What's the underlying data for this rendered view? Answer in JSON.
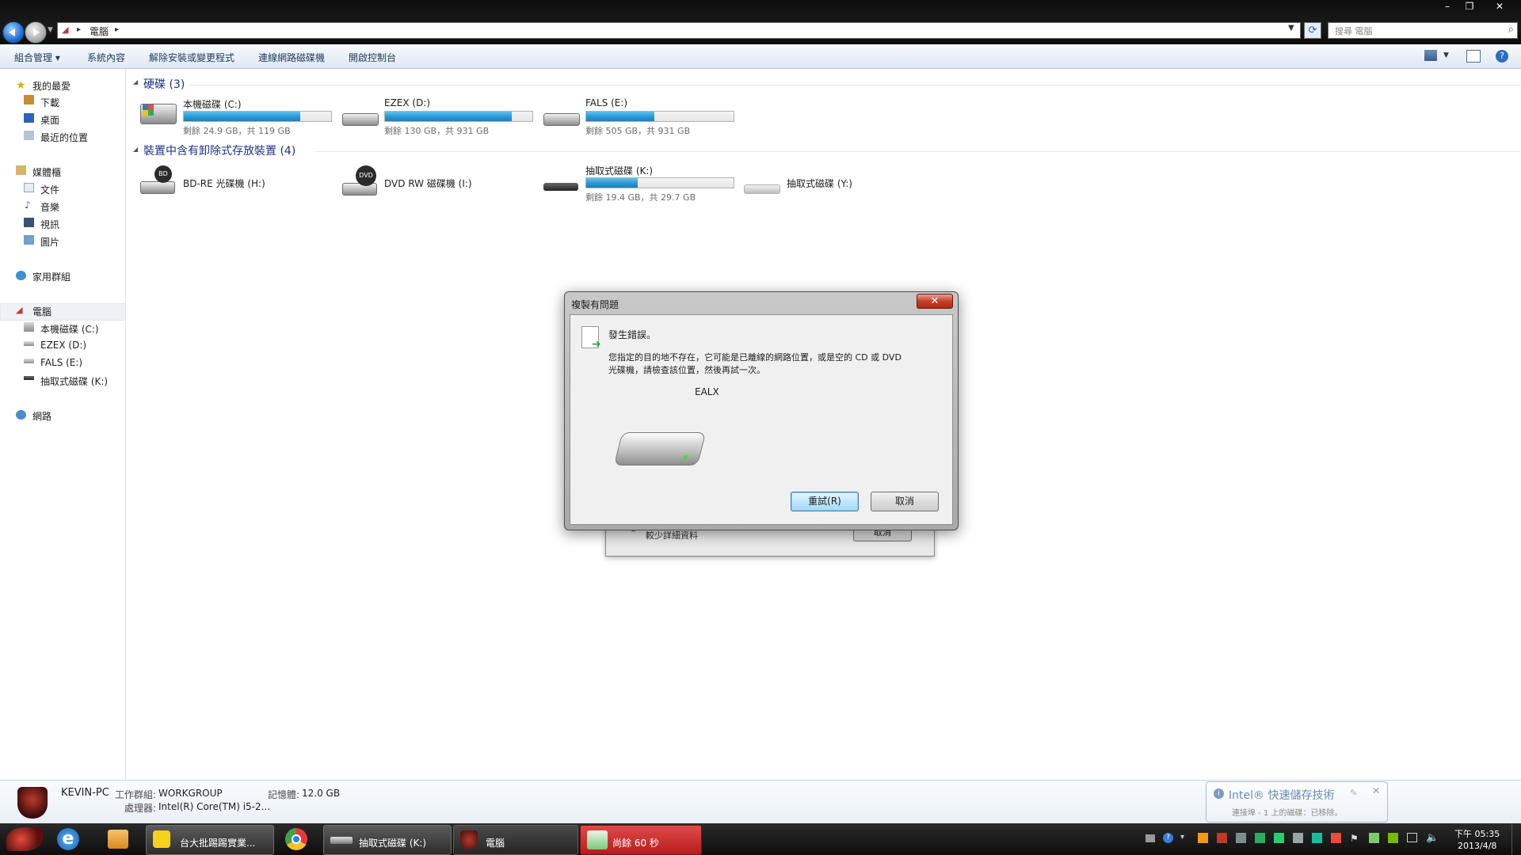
{
  "window": {
    "address": {
      "crumb": "電腦"
    },
    "search_placeholder": "搜尋 電腦",
    "controls": {
      "minimize": "–",
      "restore": "❐",
      "close": "✕"
    }
  },
  "command_bar": {
    "organize": "組合管理",
    "system_properties": "系統內容",
    "uninstall": "解除安裝或變更程式",
    "map_drive": "連線網路磁碟機",
    "control_panel": "開啟控制台"
  },
  "nav": {
    "favorites": "我的最愛",
    "downloads": "下載",
    "desktop": "桌面",
    "recent": "最近的位置",
    "libraries": "媒體櫃",
    "documents": "文件",
    "music": "音樂",
    "videos": "視訊",
    "pictures": "圖片",
    "homegroup": "家用群組",
    "computer": "電腦",
    "drive_c": "本機磁碟 (C:)",
    "drive_d": "EZEX (D:)",
    "drive_e": "FALS (E:)",
    "drive_k": "抽取式磁碟 (K:)",
    "network": "網路"
  },
  "content": {
    "hard_disks_header": "硬碟 (3)",
    "removable_header": "裝置中含有卸除式存放裝置 (4)",
    "drives": [
      {
        "name": "本機磁碟 (C:)",
        "free": "剩餘 24.9 GB，共 119 GB",
        "used_fraction": 0.79
      },
      {
        "name": "EZEX (D:)",
        "free": "剩餘 130 GB，共 931 GB",
        "used_fraction": 0.86
      },
      {
        "name": "FALS (E:)",
        "free": "剩餘 505 GB，共 931 GB",
        "used_fraction": 0.46
      }
    ],
    "removable": [
      {
        "name": "BD-RE 光碟機 (H:)",
        "badge": "BD"
      },
      {
        "name": "DVD RW 磁碟機 (I:)",
        "badge": "DVD"
      },
      {
        "name": "抽取式磁碟 (K:)",
        "free": "剩餘 19.4 GB，共 29.7 GB",
        "used_fraction": 0.35
      },
      {
        "name": "抽取式磁碟 (Y:)"
      }
    ]
  },
  "dialog": {
    "title": "複製有問題",
    "close": "✕",
    "heading": "發生錯誤。",
    "message_line1": "您指定的目的地不存在，它可能是已離線的網路位置，或是空的 CD 或 DVD",
    "message_line2": "光碟機，請檢查該位置，然後再試一次。",
    "item_name": "EALX",
    "retry_label": "重試(R)",
    "cancel_label": "取消"
  },
  "dialog_behind": {
    "less_details": "較少詳細資料",
    "cancel_label": "取消"
  },
  "details": {
    "pc_name": "KEVIN-PC",
    "workgroup_label": "工作群組:",
    "workgroup_value": "WORKGROUP",
    "memory_label": "記憶體:",
    "memory_value": "12.0 GB",
    "cpu_label": "處理器:",
    "cpu_value": "Intel(R) Core(TM) i5-2..."
  },
  "toast": {
    "title": "Intel® 快速儲存技術",
    "body": "連接埠 - 1 上的磁碟：已移除。"
  },
  "taskbar": {
    "item1": "台大批踢踢實業...",
    "item2": "抽取式磁碟 (K:)",
    "item3": "電腦",
    "item4": "尚餘 60 秒",
    "time": "下午 05:35",
    "date": "2013/4/8"
  }
}
